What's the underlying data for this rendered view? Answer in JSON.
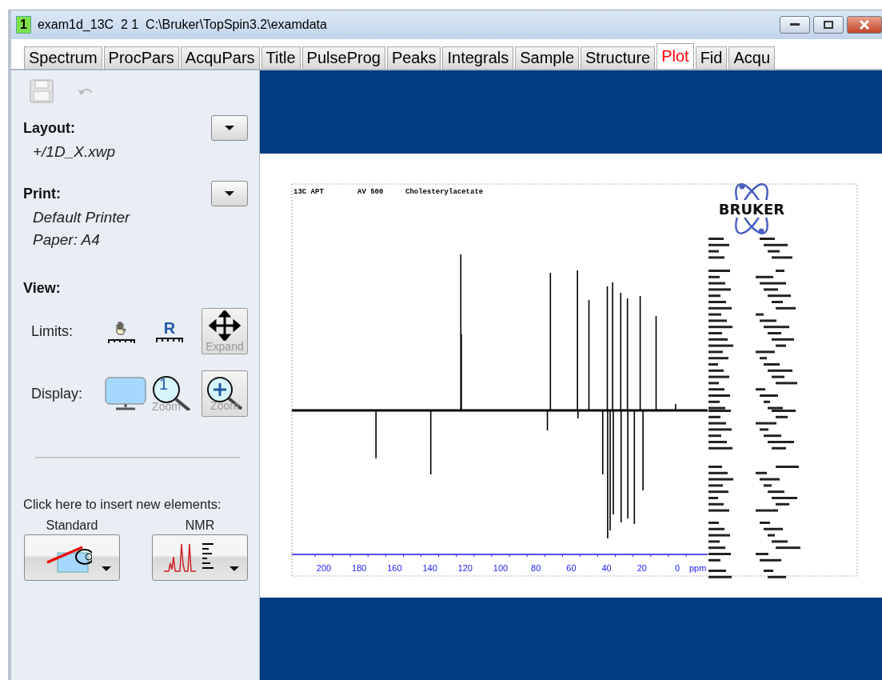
{
  "window": {
    "badge": "1",
    "title": "exam1d_13C  2 1  C:\\Bruker\\TopSpin3.2\\examdata"
  },
  "tabs": [
    {
      "label": "Spectrum",
      "selected": false
    },
    {
      "label": "ProcPars",
      "selected": false
    },
    {
      "label": "AcquPars",
      "selected": false
    },
    {
      "label": "Title",
      "selected": false
    },
    {
      "label": "PulseProg",
      "selected": false
    },
    {
      "label": "Peaks",
      "selected": false
    },
    {
      "label": "Integrals",
      "selected": false
    },
    {
      "label": "Sample",
      "selected": false
    },
    {
      "label": "Structure",
      "selected": false
    },
    {
      "label": "Plot",
      "selected": true
    },
    {
      "label": "Fid",
      "selected": false
    },
    {
      "label": "Acqu",
      "selected": false
    }
  ],
  "sidebar": {
    "layout": {
      "label": "Layout:",
      "value": "+/1D_X.xwp"
    },
    "print": {
      "label": "Print:",
      "lines": [
        "Default Printer",
        "Paper: A4"
      ]
    },
    "view": {
      "label": "View:",
      "limits_label": "Limits:",
      "limits_caption": "R",
      "expand_caption": "Expand",
      "display_label": "Display:",
      "zoom_captions": [
        "Zoom",
        "Zoom"
      ],
      "zoom_badge": "1"
    },
    "insert": {
      "prompt": "Click here to insert new elements:",
      "buttons": [
        "Standard",
        "NMR"
      ]
    }
  },
  "plot": {
    "title_parts": [
      "13C APT",
      "AV 500",
      "Cholesterylacetate"
    ],
    "logo": "BRUKER",
    "x_ticks": [
      "200",
      "180",
      "160",
      "140",
      "120",
      "100",
      "80",
      "60",
      "40",
      "20",
      "0"
    ],
    "x_unit": "ppm"
  }
}
